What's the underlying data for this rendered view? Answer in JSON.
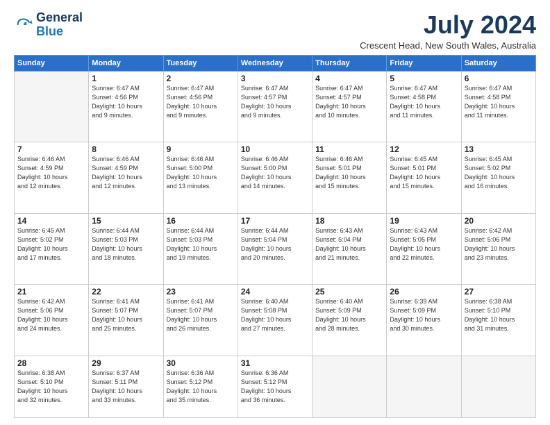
{
  "logo": {
    "line1": "General",
    "line2": "Blue"
  },
  "title": "July 2024",
  "location": "Crescent Head, New South Wales, Australia",
  "days_of_week": [
    "Sunday",
    "Monday",
    "Tuesday",
    "Wednesday",
    "Thursday",
    "Friday",
    "Saturday"
  ],
  "weeks": [
    [
      {
        "day": "",
        "info": ""
      },
      {
        "day": "1",
        "info": "Sunrise: 6:47 AM\nSunset: 4:56 PM\nDaylight: 10 hours\nand 9 minutes."
      },
      {
        "day": "2",
        "info": "Sunrise: 6:47 AM\nSunset: 4:56 PM\nDaylight: 10 hours\nand 9 minutes."
      },
      {
        "day": "3",
        "info": "Sunrise: 6:47 AM\nSunset: 4:57 PM\nDaylight: 10 hours\nand 9 minutes."
      },
      {
        "day": "4",
        "info": "Sunrise: 6:47 AM\nSunset: 4:57 PM\nDaylight: 10 hours\nand 10 minutes."
      },
      {
        "day": "5",
        "info": "Sunrise: 6:47 AM\nSunset: 4:58 PM\nDaylight: 10 hours\nand 11 minutes."
      },
      {
        "day": "6",
        "info": "Sunrise: 6:47 AM\nSunset: 4:58 PM\nDaylight: 10 hours\nand 11 minutes."
      }
    ],
    [
      {
        "day": "7",
        "info": "Sunrise: 6:46 AM\nSunset: 4:59 PM\nDaylight: 10 hours\nand 12 minutes."
      },
      {
        "day": "8",
        "info": "Sunrise: 6:46 AM\nSunset: 4:59 PM\nDaylight: 10 hours\nand 12 minutes."
      },
      {
        "day": "9",
        "info": "Sunrise: 6:46 AM\nSunset: 5:00 PM\nDaylight: 10 hours\nand 13 minutes."
      },
      {
        "day": "10",
        "info": "Sunrise: 6:46 AM\nSunset: 5:00 PM\nDaylight: 10 hours\nand 14 minutes."
      },
      {
        "day": "11",
        "info": "Sunrise: 6:46 AM\nSunset: 5:01 PM\nDaylight: 10 hours\nand 15 minutes."
      },
      {
        "day": "12",
        "info": "Sunrise: 6:45 AM\nSunset: 5:01 PM\nDaylight: 10 hours\nand 15 minutes."
      },
      {
        "day": "13",
        "info": "Sunrise: 6:45 AM\nSunset: 5:02 PM\nDaylight: 10 hours\nand 16 minutes."
      }
    ],
    [
      {
        "day": "14",
        "info": "Sunrise: 6:45 AM\nSunset: 5:02 PM\nDaylight: 10 hours\nand 17 minutes."
      },
      {
        "day": "15",
        "info": "Sunrise: 6:44 AM\nSunset: 5:03 PM\nDaylight: 10 hours\nand 18 minutes."
      },
      {
        "day": "16",
        "info": "Sunrise: 6:44 AM\nSunset: 5:03 PM\nDaylight: 10 hours\nand 19 minutes."
      },
      {
        "day": "17",
        "info": "Sunrise: 6:44 AM\nSunset: 5:04 PM\nDaylight: 10 hours\nand 20 minutes."
      },
      {
        "day": "18",
        "info": "Sunrise: 6:43 AM\nSunset: 5:04 PM\nDaylight: 10 hours\nand 21 minutes."
      },
      {
        "day": "19",
        "info": "Sunrise: 6:43 AM\nSunset: 5:05 PM\nDaylight: 10 hours\nand 22 minutes."
      },
      {
        "day": "20",
        "info": "Sunrise: 6:42 AM\nSunset: 5:06 PM\nDaylight: 10 hours\nand 23 minutes."
      }
    ],
    [
      {
        "day": "21",
        "info": "Sunrise: 6:42 AM\nSunset: 5:06 PM\nDaylight: 10 hours\nand 24 minutes."
      },
      {
        "day": "22",
        "info": "Sunrise: 6:41 AM\nSunset: 5:07 PM\nDaylight: 10 hours\nand 25 minutes."
      },
      {
        "day": "23",
        "info": "Sunrise: 6:41 AM\nSunset: 5:07 PM\nDaylight: 10 hours\nand 26 minutes."
      },
      {
        "day": "24",
        "info": "Sunrise: 6:40 AM\nSunset: 5:08 PM\nDaylight: 10 hours\nand 27 minutes."
      },
      {
        "day": "25",
        "info": "Sunrise: 6:40 AM\nSunset: 5:09 PM\nDaylight: 10 hours\nand 28 minutes."
      },
      {
        "day": "26",
        "info": "Sunrise: 6:39 AM\nSunset: 5:09 PM\nDaylight: 10 hours\nand 30 minutes."
      },
      {
        "day": "27",
        "info": "Sunrise: 6:38 AM\nSunset: 5:10 PM\nDaylight: 10 hours\nand 31 minutes."
      }
    ],
    [
      {
        "day": "28",
        "info": "Sunrise: 6:38 AM\nSunset: 5:10 PM\nDaylight: 10 hours\nand 32 minutes."
      },
      {
        "day": "29",
        "info": "Sunrise: 6:37 AM\nSunset: 5:11 PM\nDaylight: 10 hours\nand 33 minutes."
      },
      {
        "day": "30",
        "info": "Sunrise: 6:36 AM\nSunset: 5:12 PM\nDaylight: 10 hours\nand 35 minutes."
      },
      {
        "day": "31",
        "info": "Sunrise: 6:36 AM\nSunset: 5:12 PM\nDaylight: 10 hours\nand 36 minutes."
      },
      {
        "day": "",
        "info": ""
      },
      {
        "day": "",
        "info": ""
      },
      {
        "day": "",
        "info": ""
      }
    ]
  ]
}
